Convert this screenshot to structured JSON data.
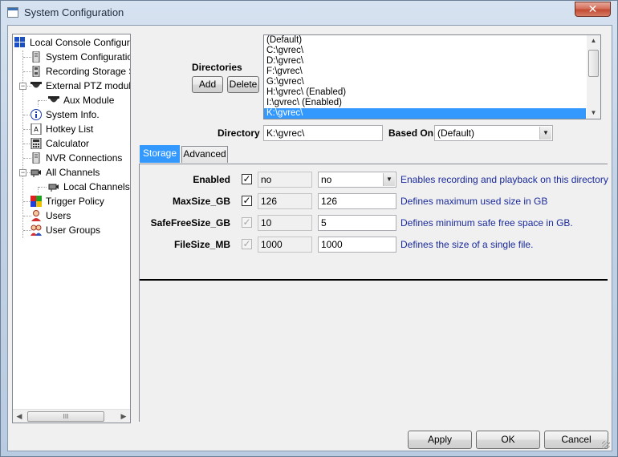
{
  "window": {
    "title": "System Configuration",
    "close_label": "✕"
  },
  "tree": {
    "items": [
      {
        "label": "Local Console Configurati",
        "icon": "grid-icon"
      },
      {
        "label": "System Configuration",
        "icon": "server-icon"
      },
      {
        "label": "Recording Storage Se",
        "icon": "storage-icon"
      },
      {
        "label": "External PTZ module",
        "icon": "ptz-camera-icon"
      },
      {
        "label": "Aux Module",
        "icon": "ptz-camera-icon"
      },
      {
        "label": "System Info.",
        "icon": "info-icon"
      },
      {
        "label": "Hotkey List",
        "icon": "hotkey-icon"
      },
      {
        "label": "Calculator",
        "icon": "calculator-icon"
      },
      {
        "label": "NVR Connections",
        "icon": "server-icon"
      },
      {
        "label": "All Channels",
        "icon": "camera-icon"
      },
      {
        "label": "Local Channels",
        "icon": "camera-icon"
      },
      {
        "label": "Trigger Policy",
        "icon": "policy-icon"
      },
      {
        "label": "Users",
        "icon": "user-icon"
      },
      {
        "label": "User Groups",
        "icon": "user-group-icon"
      }
    ],
    "scroll_grip": "III"
  },
  "directories": {
    "label": "Directories",
    "add_label": "Add",
    "delete_label": "Delete",
    "list": [
      "(Default)",
      "C:\\gvrec\\",
      "D:\\gvrec\\",
      "F:\\gvrec\\",
      "G:\\gvrec\\",
      "H:\\gvrec\\ (Enabled)",
      "I:\\gvrec\\ (Enabled)",
      "K:\\gvrec\\"
    ],
    "selected_index": 7
  },
  "directory_field": {
    "label": "Directory",
    "value": "K:\\gvrec\\"
  },
  "based_on": {
    "label": "Based On",
    "value": "(Default)"
  },
  "tabs": [
    {
      "label": "Storage",
      "active": true
    },
    {
      "label": "Advanced",
      "active": false
    }
  ],
  "properties": [
    {
      "name": "Enabled",
      "checked": true,
      "enabled": true,
      "base": "no",
      "value": "no",
      "is_combo": true,
      "description": "Enables recording and playback on this directory"
    },
    {
      "name": "MaxSize_GB",
      "checked": true,
      "enabled": true,
      "base": "126",
      "value": "126",
      "is_combo": false,
      "description": "Defines maximum used size in GB"
    },
    {
      "name": "SafeFreeSize_GB",
      "checked": true,
      "enabled": false,
      "base": "10",
      "value": "5",
      "is_combo": false,
      "description": "Defines minimum safe free space in GB."
    },
    {
      "name": "FileSize_MB",
      "checked": true,
      "enabled": false,
      "base": "1000",
      "value": "1000",
      "is_combo": false,
      "description": "Defines the size of a single file."
    }
  ],
  "buttons": {
    "apply": "Apply",
    "ok": "OK",
    "cancel": "Cancel"
  },
  "colors": {
    "selection": "#3399ff",
    "description_text": "#1a2a9c"
  }
}
